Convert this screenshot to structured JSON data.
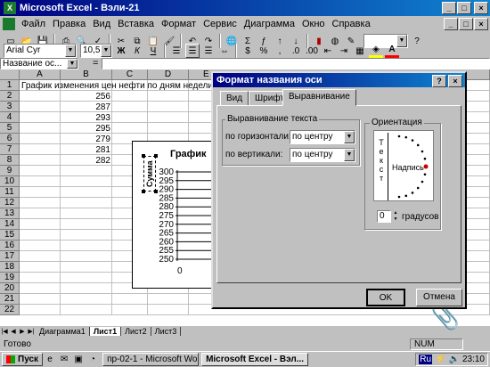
{
  "window": {
    "title": "Microsoft Excel - Вэли-21",
    "logo": "X"
  },
  "menu": [
    "Файл",
    "Правка",
    "Вид",
    "Вставка",
    "Формат",
    "Сервис",
    "Диаграмма",
    "Окно",
    "Справка"
  ],
  "format_toolbar": {
    "font": "Arial Cyr",
    "size": "10,5",
    "bold": "Ж",
    "italic": "К",
    "underline": "Ч"
  },
  "formula_bar": {
    "name_box": "Название ос...",
    "equals": "="
  },
  "grid": {
    "columns": [
      "A",
      "B",
      "C",
      "D",
      "E"
    ],
    "rows": [
      "1",
      "2",
      "3",
      "4",
      "5",
      "6",
      "7",
      "8",
      "9",
      "10",
      "11",
      "12",
      "13",
      "14",
      "15",
      "16",
      "17",
      "18",
      "19",
      "20",
      "21",
      "22"
    ],
    "a1": "График изменения цен нефти по дням недели",
    "b_values": [
      "256",
      "287",
      "293",
      "295",
      "279",
      "281",
      "282"
    ]
  },
  "chart": {
    "title": "График",
    "axis_title": "Сумма",
    "y_ticks": [
      "300",
      "295",
      "290",
      "285",
      "280",
      "275",
      "270",
      "265",
      "260",
      "255",
      "250"
    ],
    "x_zero": "0"
  },
  "sheet_tabs": [
    "Диаграмма1",
    "Лист1",
    "Лист2",
    "Лист3"
  ],
  "status": {
    "left": "Готово",
    "num": "NUM"
  },
  "dialog": {
    "title": "Формат названия оси",
    "help": "?",
    "close": "×",
    "tabs": [
      "Вид",
      "Шрифт",
      "Выравнивание"
    ],
    "align_group": "Выравнивание текста",
    "horiz_label": "по горизонтали:",
    "horiz_value": "по центру",
    "vert_label": "по вертикали:",
    "vert_value": "по центру",
    "orient_group": "Ориентация",
    "vertical_text": "Текст",
    "orient_label": "Надпись",
    "degrees_value": "0",
    "degrees_label": "градусов",
    "ok": "OK",
    "cancel": "Отмена"
  },
  "taskbar": {
    "start": "Пуск",
    "items": [
      "пр-02-1 - Microsoft Word",
      "Microsoft Excel - Вэл..."
    ],
    "lang": "Ru",
    "clock": "23:10"
  },
  "colors": {
    "title_bar": "#000080",
    "face": "#c0c0c0",
    "desktop": "#008080"
  }
}
